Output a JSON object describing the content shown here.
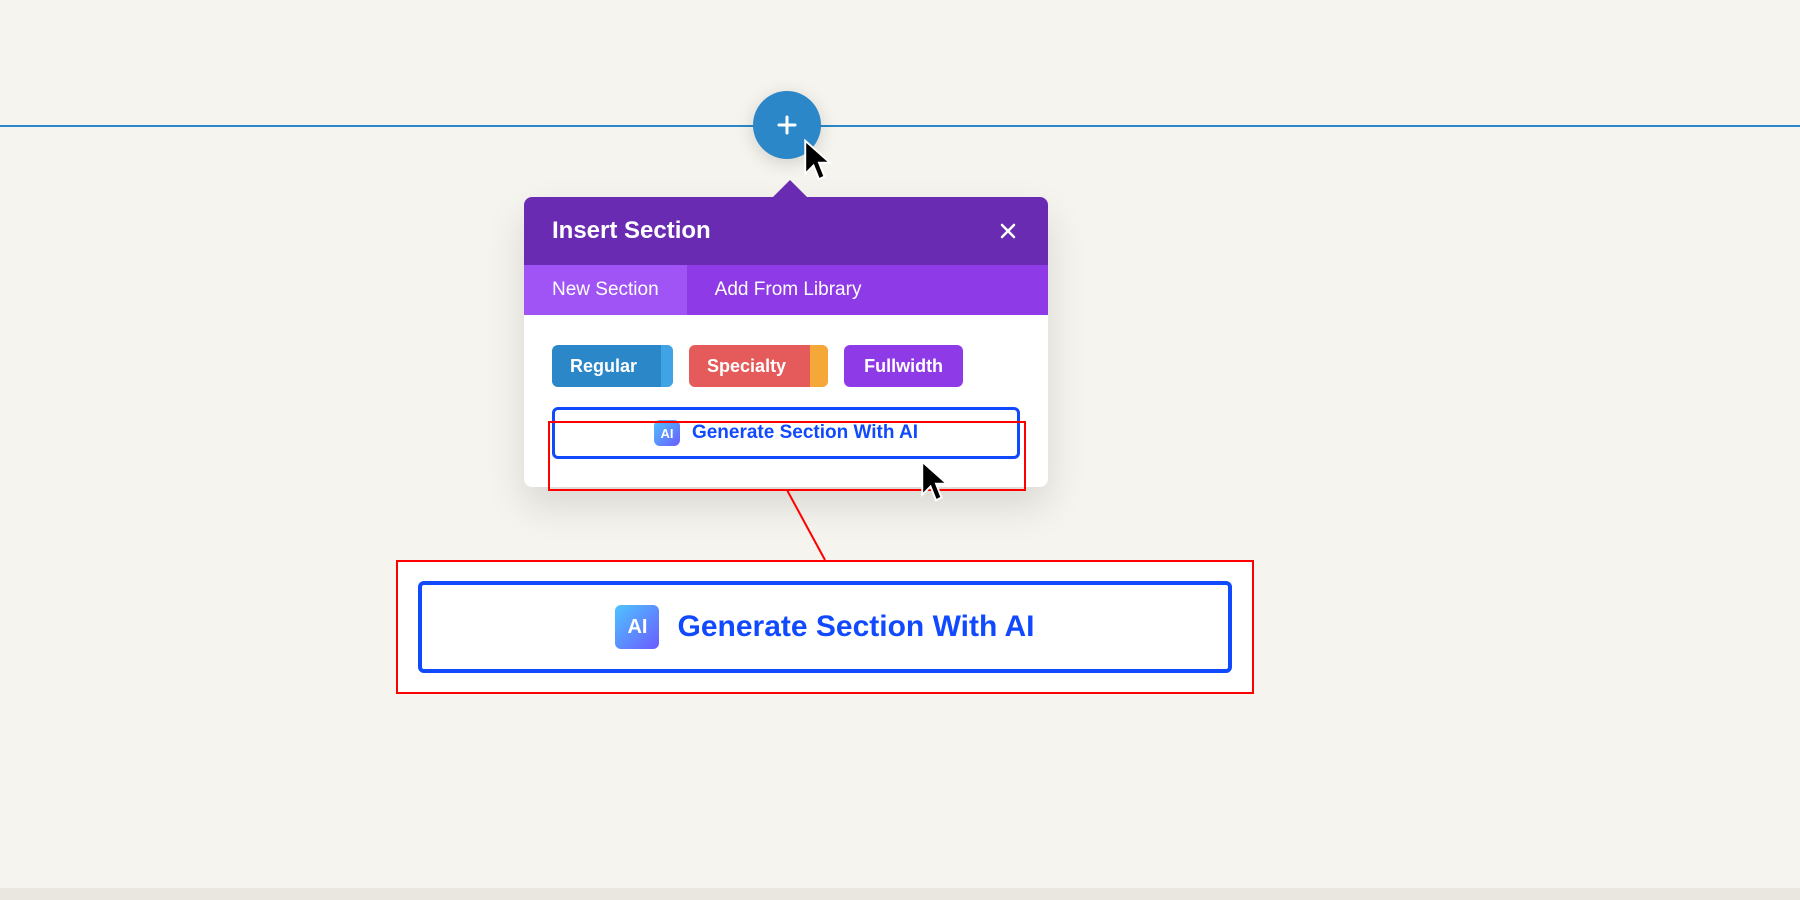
{
  "popover": {
    "title": "Insert Section",
    "tabs": [
      {
        "label": "New Section"
      },
      {
        "label": "Add From Library"
      }
    ],
    "types": {
      "regular": "Regular",
      "specialty": "Specialty",
      "fullwidth": "Fullwidth"
    },
    "ai_button_label": "Generate Section With AI",
    "ai_icon_text": "AI"
  },
  "callout": {
    "ai_button_label": "Generate Section With AI",
    "ai_icon_text": "AI"
  }
}
